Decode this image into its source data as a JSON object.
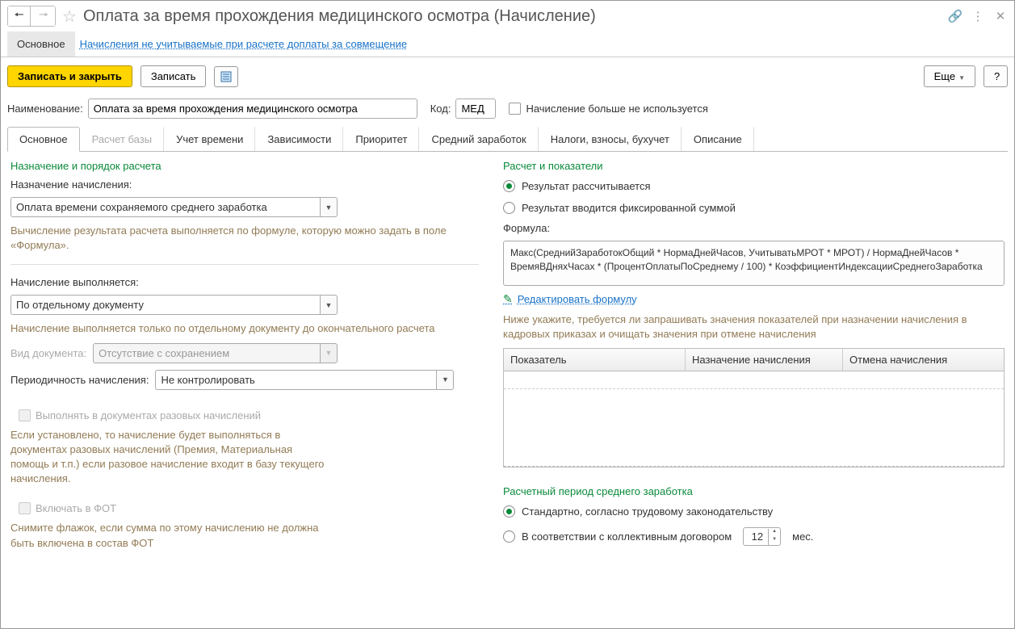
{
  "titlebar": {
    "title": "Оплата за время прохождения медицинского осмотра (Начисление)"
  },
  "subnav": {
    "main": "Основное",
    "link": "Начисления не учитываемые при расчете доплаты за совмещение"
  },
  "toolbar": {
    "save_close": "Записать и закрыть",
    "save": "Записать",
    "more": "Еще",
    "help": "?"
  },
  "header": {
    "name_label": "Наименование:",
    "name_value": "Оплата за время прохождения медицинского осмотра",
    "code_label": "Код:",
    "code_value": "МЕД",
    "not_used": "Начисление больше не используется"
  },
  "tabs": [
    "Основное",
    "Расчет базы",
    "Учет времени",
    "Зависимости",
    "Приоритет",
    "Средний заработок",
    "Налоги, взносы, бухучет",
    "Описание"
  ],
  "left": {
    "section1": "Назначение и порядок расчета",
    "purpose_label": "Назначение начисления:",
    "purpose_value": "Оплата времени сохраняемого среднего заработка",
    "purpose_hint": "Вычисление результата расчета выполняется по формуле, которую можно задать в поле «Формула».",
    "exec_label": "Начисление выполняется:",
    "exec_value": "По отдельному документу",
    "exec_hint": "Начисление выполняется только по отдельному документу до окончательного расчета",
    "doc_type_label": "Вид документа:",
    "doc_type_value": "Отсутствие с сохранением",
    "period_label": "Периодичность начисления:",
    "period_value": "Не контролировать",
    "onetime_label": "Выполнять в документах разовых начислений",
    "onetime_hint": "Если установлено, то начисление будет выполняться в документах разовых начислений (Премия, Материальная помощь и т.п.) если разовое начисление входит в базу текущего начисления.",
    "fot_label": "Включать в ФОТ",
    "fot_hint": "Снимите флажок, если сумма по этому начислению не должна быть включена в состав ФОТ"
  },
  "right": {
    "section": "Расчет и показатели",
    "r1": "Результат рассчитывается",
    "r2": "Результат вводится фиксированной суммой",
    "formula_label": "Формула:",
    "formula_text": "Макс(СреднийЗаработокОбщий * НормаДнейЧасов, УчитыватьМРОТ * МРОТ) / НормаДнейЧасов * ВремяВДняхЧасах * (ПроцентОплатыПоСреднему / 100) * КоэффициентИндексацииСреднегоЗаработка",
    "edit_formula": "Редактировать формулу",
    "table_hint": "Ниже укажите, требуется ли запрашивать значения показателей при назначении начисления в кадровых приказах и очищать значения при отмене начисления",
    "th1": "Показатель",
    "th2": "Назначение начисления",
    "th3": "Отмена начисления",
    "period_section": "Расчетный период среднего заработка",
    "p1": "Стандартно, согласно трудовому законодательству",
    "p2": "В соответствии с коллективным договором",
    "months_value": "12",
    "months_unit": "мес."
  }
}
